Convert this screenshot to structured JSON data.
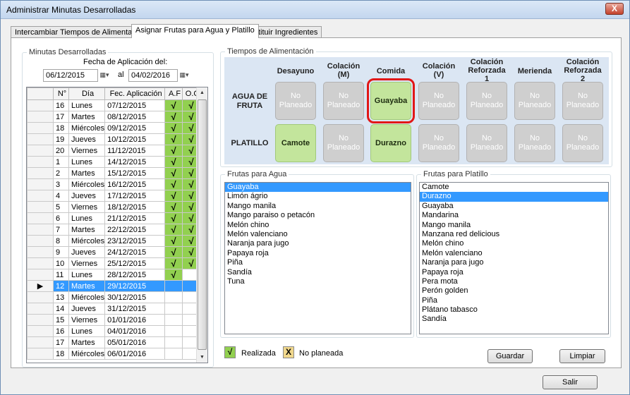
{
  "window": {
    "title": "Administrar Minutas Desarrolladas",
    "close_label": "X"
  },
  "tabs": [
    {
      "label": "Intercambiar Tiempos de Alimentación"
    },
    {
      "label": "Asignar Frutas para Agua y Platillo"
    },
    {
      "label": "Sustituir Ingredientes"
    }
  ],
  "minutas": {
    "group_label": "Minutas Desarrolladas",
    "date_label": "Fecha de Aplicación del:",
    "date_from": "06/12/2015",
    "date_sep": "al",
    "date_to": "04/02/2016",
    "dropdown_glyph": "▦▾",
    "columns": [
      "N°",
      "Día",
      "Fec. Aplicación",
      "A.F",
      "O.C"
    ],
    "check_mark": "√",
    "row_pointer": "▶",
    "rows": [
      {
        "n": "16",
        "dia": "Lunes",
        "fecha": "07/12/2015",
        "af": true,
        "oc": true,
        "sel": false
      },
      {
        "n": "17",
        "dia": "Martes",
        "fecha": "08/12/2015",
        "af": true,
        "oc": true,
        "sel": false
      },
      {
        "n": "18",
        "dia": "Miércoles",
        "fecha": "09/12/2015",
        "af": true,
        "oc": true,
        "sel": false
      },
      {
        "n": "19",
        "dia": "Jueves",
        "fecha": "10/12/2015",
        "af": true,
        "oc": true,
        "sel": false
      },
      {
        "n": "20",
        "dia": "Viernes",
        "fecha": "11/12/2015",
        "af": true,
        "oc": true,
        "sel": false
      },
      {
        "n": "1",
        "dia": "Lunes",
        "fecha": "14/12/2015",
        "af": true,
        "oc": true,
        "sel": false
      },
      {
        "n": "2",
        "dia": "Martes",
        "fecha": "15/12/2015",
        "af": true,
        "oc": true,
        "sel": false
      },
      {
        "n": "3",
        "dia": "Miércoles",
        "fecha": "16/12/2015",
        "af": true,
        "oc": true,
        "sel": false
      },
      {
        "n": "4",
        "dia": "Jueves",
        "fecha": "17/12/2015",
        "af": true,
        "oc": true,
        "sel": false
      },
      {
        "n": "5",
        "dia": "Viernes",
        "fecha": "18/12/2015",
        "af": true,
        "oc": true,
        "sel": false
      },
      {
        "n": "6",
        "dia": "Lunes",
        "fecha": "21/12/2015",
        "af": true,
        "oc": true,
        "sel": false
      },
      {
        "n": "7",
        "dia": "Martes",
        "fecha": "22/12/2015",
        "af": true,
        "oc": true,
        "sel": false
      },
      {
        "n": "8",
        "dia": "Miércoles",
        "fecha": "23/12/2015",
        "af": true,
        "oc": true,
        "sel": false
      },
      {
        "n": "9",
        "dia": "Jueves",
        "fecha": "24/12/2015",
        "af": true,
        "oc": true,
        "sel": false
      },
      {
        "n": "10",
        "dia": "Viernes",
        "fecha": "25/12/2015",
        "af": true,
        "oc": true,
        "sel": false
      },
      {
        "n": "11",
        "dia": "Lunes",
        "fecha": "28/12/2015",
        "af": true,
        "oc": false,
        "sel": false
      },
      {
        "n": "12",
        "dia": "Martes",
        "fecha": "29/12/2015",
        "af": false,
        "oc": false,
        "sel": true
      },
      {
        "n": "13",
        "dia": "Miércoles",
        "fecha": "30/12/2015",
        "af": false,
        "oc": false,
        "sel": false
      },
      {
        "n": "14",
        "dia": "Jueves",
        "fecha": "31/12/2015",
        "af": false,
        "oc": false,
        "sel": false
      },
      {
        "n": "15",
        "dia": "Viernes",
        "fecha": "01/01/2016",
        "af": false,
        "oc": false,
        "sel": false
      },
      {
        "n": "16",
        "dia": "Lunes",
        "fecha": "04/01/2016",
        "af": false,
        "oc": false,
        "sel": false
      },
      {
        "n": "17",
        "dia": "Martes",
        "fecha": "05/01/2016",
        "af": false,
        "oc": false,
        "sel": false
      },
      {
        "n": "18",
        "dia": "Miércoles",
        "fecha": "06/01/2016",
        "af": false,
        "oc": false,
        "sel": false
      }
    ]
  },
  "tiempos": {
    "group_label": "Tiempos de Alimentación",
    "columns": [
      {
        "label": "Desayuno"
      },
      {
        "label": "Colación\n(M)"
      },
      {
        "label": "Comida"
      },
      {
        "label": "Colación\n(V)"
      },
      {
        "label": "Colación\nReforzada\n1"
      },
      {
        "label": "Merienda"
      },
      {
        "label": "Colación\nReforzada\n2"
      }
    ],
    "rows": [
      {
        "label": "AGUA DE\nFRUTA",
        "cells": [
          {
            "text": "No\nPlaneado",
            "state": "empty"
          },
          {
            "text": "No\nPlaneado",
            "state": "empty"
          },
          {
            "text": "Guayaba",
            "state": "assigned",
            "highlight": true
          },
          {
            "text": "No\nPlaneado",
            "state": "empty"
          },
          {
            "text": "No\nPlaneado",
            "state": "empty"
          },
          {
            "text": "No\nPlaneado",
            "state": "empty"
          },
          {
            "text": "No\nPlaneado",
            "state": "empty"
          }
        ]
      },
      {
        "label": "PLATILLO",
        "cells": [
          {
            "text": "Camote",
            "state": "assigned"
          },
          {
            "text": "No\nPlaneado",
            "state": "empty"
          },
          {
            "text": "Durazno",
            "state": "assigned"
          },
          {
            "text": "No\nPlaneado",
            "state": "empty"
          },
          {
            "text": "No\nPlaneado",
            "state": "empty"
          },
          {
            "text": "No\nPlaneado",
            "state": "empty"
          },
          {
            "text": "No\nPlaneado",
            "state": "empty"
          }
        ]
      }
    ]
  },
  "frutas_agua": {
    "group_label": "Frutas para Agua",
    "selected": "Guayaba",
    "items": [
      "Guayaba",
      "Limón ágrio",
      "Mango manila",
      "Mango paraiso o petacón",
      "Melón chino",
      "Melón valenciano",
      "Naranja para jugo",
      "Papaya roja",
      "Piña",
      "Sandía",
      "Tuna"
    ]
  },
  "frutas_platillo": {
    "group_label": "Frutas para Platillo",
    "selected": "Durazno",
    "items": [
      "Camote",
      "Durazno",
      "Guayaba",
      "Mandarina",
      "Mango manila",
      "Manzana red delicious",
      "Melón chino",
      "Melón valenciano",
      "Naranja para jugo",
      "Papaya roja",
      "Pera mota",
      "Perón golden",
      "Piña",
      "Plátano tabasco",
      "Sandía"
    ]
  },
  "legend": {
    "realizada_symbol": "√",
    "realizada_label": "Realizada",
    "no_planeada_symbol": "X",
    "no_planeada_label": "No planeada"
  },
  "buttons": {
    "guardar": "Guardar",
    "limpiar": "Limpiar",
    "salir": "Salir"
  },
  "colors": {
    "assigned": "#c3e59c",
    "empty": "#cfcfcf",
    "check": "#92d050",
    "no_planeada": "#f0d78c",
    "selection": "#3399ff",
    "highlight": "#e11717"
  }
}
